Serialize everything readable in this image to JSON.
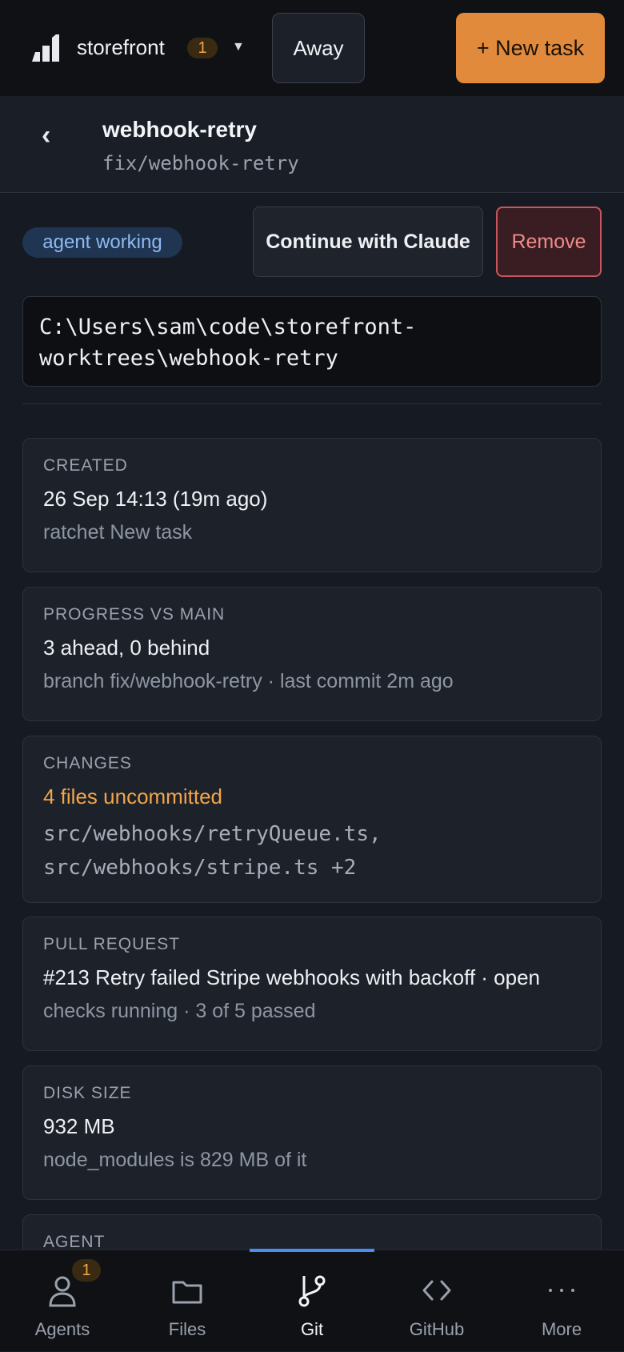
{
  "topbar": {
    "project_name": "storefront",
    "project_count": "1",
    "away_label": "Away",
    "new_task_label": "+ New task",
    "accent_color": "#e18a3c"
  },
  "task": {
    "title": "webhook-retry",
    "branch": "fix/webhook-retry",
    "status": "agent working",
    "continue_label": "Continue with Claude",
    "remove_label": "Remove",
    "path_line1": "C:\\Users\\sam\\code\\storefront-",
    "path_line2": "worktrees\\webhook-retry"
  },
  "cards": {
    "created": {
      "label": "CREATED",
      "value": "26 Sep 14:13 (19m ago)",
      "sub": "ratchet New task"
    },
    "progress": {
      "label": "PROGRESS VS MAIN",
      "value": "3 ahead, 0 behind",
      "sub": "branch fix/webhook-retry · last commit 2m ago"
    },
    "changes": {
      "label": "CHANGES",
      "value": "4 files uncommitted",
      "files_line1": "src/webhooks/retryQueue.ts,",
      "files_line2": "src/webhooks/stripe.ts +2"
    },
    "pull_request": {
      "label": "PULL REQUEST",
      "value": "#213 Retry failed Stripe webhooks with backoff · open",
      "sub": "checks running · 3 of 5 passed"
    },
    "disk": {
      "label": "DISK SIZE",
      "value": "932 MB",
      "sub": "node_modules is 829 MB of it"
    },
    "agent": {
      "label": "AGENT"
    }
  },
  "nav": {
    "agents": "Agents",
    "agents_badge": "1",
    "files": "Files",
    "git": "Git",
    "github": "GitHub",
    "more": "More",
    "active": "git"
  }
}
